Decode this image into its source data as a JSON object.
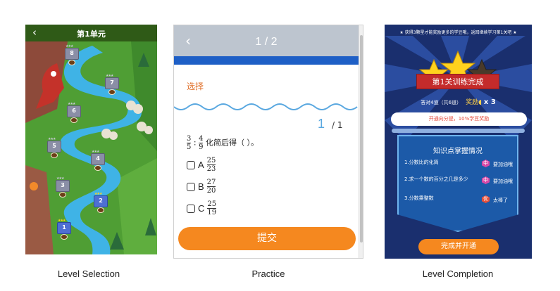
{
  "captions": [
    "Level Selection",
    "Practice",
    "Level Completion"
  ],
  "level_selection": {
    "title": "第1单元",
    "back_icon": "chevron-left-icon",
    "levels": [
      {
        "num": "8",
        "done": false
      },
      {
        "num": "7",
        "done": false
      },
      {
        "num": "6",
        "done": false
      },
      {
        "num": "5",
        "done": false
      },
      {
        "num": "4",
        "done": false
      },
      {
        "num": "3",
        "done": false
      },
      {
        "num": "2",
        "done": true
      },
      {
        "num": "1",
        "done": true
      }
    ],
    "colors": {
      "header": "#2f5a17",
      "river": "#3fb3e6",
      "grass": "#4f9e34"
    }
  },
  "practice": {
    "progress": "1 / 2",
    "section": "选择",
    "current": "1",
    "total": "/ 1",
    "stem": {
      "a_num": "3",
      "a_den": "5",
      "sep": ":",
      "b_num": "4",
      "b_den": "9",
      "text": "化简后得（ ）。"
    },
    "options": [
      {
        "letter": "A",
        "num": "25",
        "den": "23"
      },
      {
        "letter": "B",
        "num": "27",
        "den": "20"
      },
      {
        "letter": "C",
        "num": "25",
        "den": "19"
      }
    ],
    "submit": "提交",
    "colors": {
      "accent": "#f5881f",
      "section": "#e0702a"
    }
  },
  "completion": {
    "tip": "★ 获得3颗星才能奖励更多的学豆哦，返回继续学习第1关吧 ★",
    "ribbon": "第1关训练完成",
    "correct": "答对4道（共6道）",
    "reward_label": "奖励",
    "reward_count": "x 3",
    "tip2": "开通向分提，10%学豆奖励",
    "knowledge_title": "知识点掌握情况",
    "items": [
      {
        "q": "1.分数比的化简",
        "badge": "中",
        "status": "要加油哦",
        "color": "#d94aa8"
      },
      {
        "q": "2.求一个数的百分之几是多少",
        "badge": "中",
        "status": "要加油哦",
        "color": "#d94aa8"
      },
      {
        "q": "3.分数乘整数",
        "badge": "优",
        "status": "太棒了",
        "color": "#e8503a"
      }
    ],
    "cta": "完成并开通",
    "stars_earned": 2
  }
}
